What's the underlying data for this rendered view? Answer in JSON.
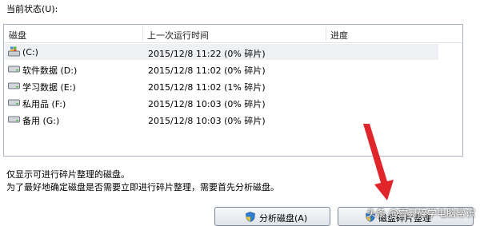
{
  "status_label": "当前状态(U):",
  "columns": {
    "disk": "磁盘",
    "last_run": "上一次运行时间",
    "progress": "进度"
  },
  "disks": [
    {
      "name": "(C:)",
      "last_run": "2015/12/8 11:22 (0% 碎片)",
      "icon": "windows-drive-icon"
    },
    {
      "name": "软件数据 (D:)",
      "last_run": "2015/12/8 11:02 (0% 碎片)",
      "icon": "drive-icon"
    },
    {
      "name": "学习数据 (E:)",
      "last_run": "2015/12/8 11:02 (1% 碎片)",
      "icon": "drive-icon"
    },
    {
      "name": "私用品 (F:)",
      "last_run": "2015/12/8 10:03 (0% 碎片)",
      "icon": "drive-icon"
    },
    {
      "name": "备用 (G:)",
      "last_run": "2015/12/8 10:03 (0% 碎片)",
      "icon": "drive-icon"
    }
  ],
  "notes": [
    "仅显示可进行碎片整理的磁盘。",
    "为了最好地确定磁盘是否需要立即进行碎片整理，需要首先分析磁盘。"
  ],
  "buttons": {
    "analyze": "分析磁盘(A)",
    "defrag": "磁盘碎片整理"
  },
  "watermark": "头条 @雪舞碎学电脑常识",
  "colors": {
    "annotation_arrow": "#e0252b"
  }
}
